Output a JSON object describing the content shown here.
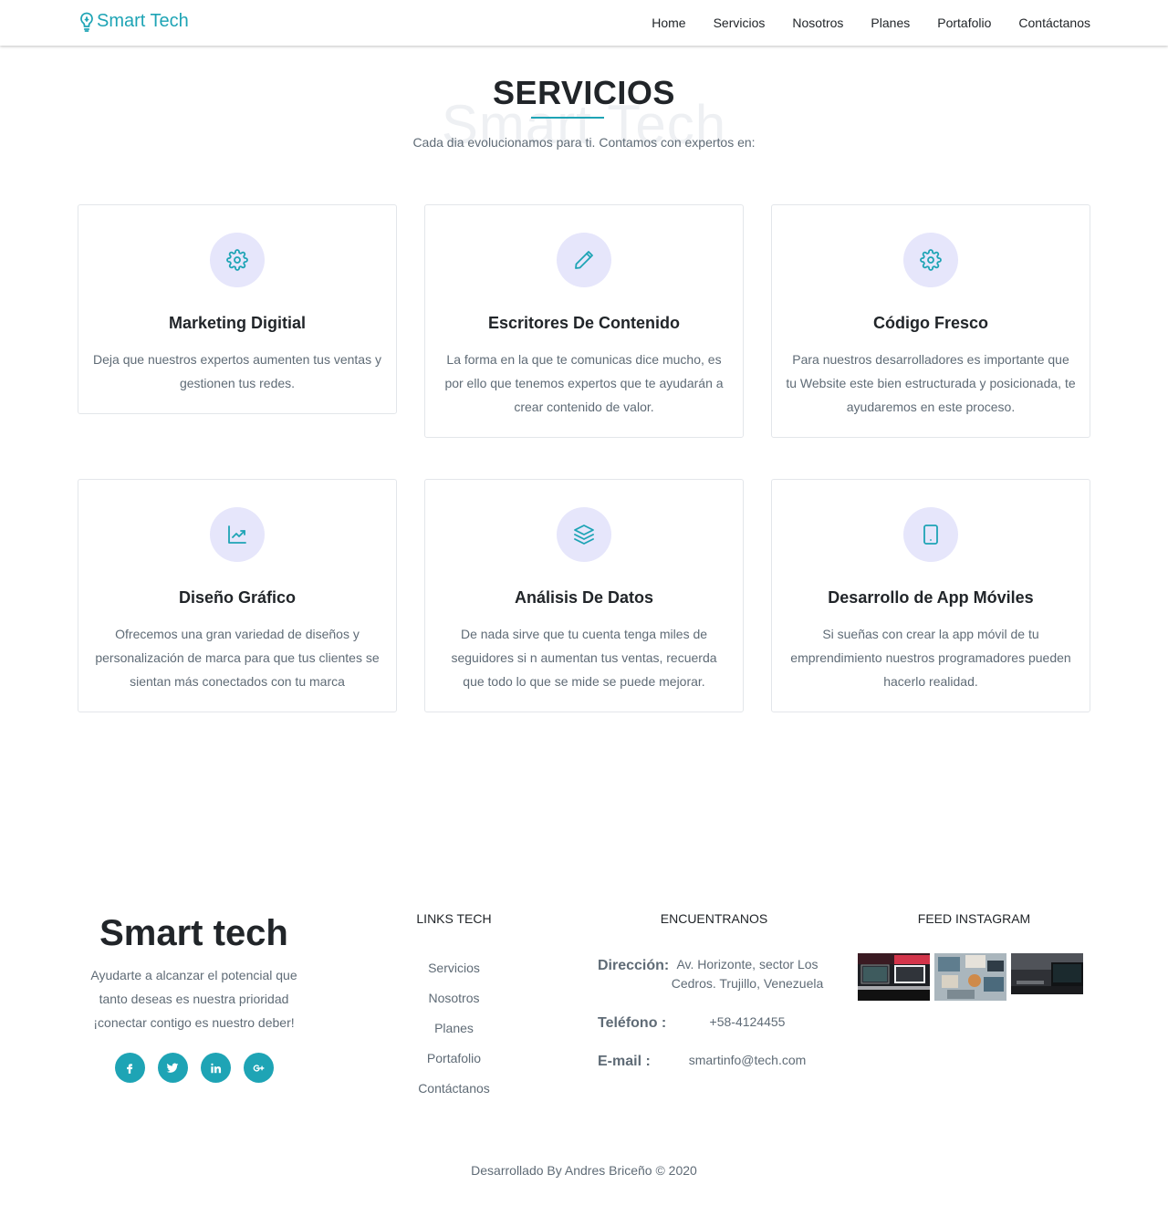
{
  "navbar": {
    "brand": "Smart Tech",
    "links": [
      "Home",
      "Servicios",
      "Nosotros",
      "Planes",
      "Portafolio",
      "Contáctanos"
    ]
  },
  "section": {
    "watermark": "Smart Tech",
    "title": "SERVICIOS",
    "subtitle": "Cada dia evolucionamos para ti. Contamos con expertos en:"
  },
  "services": [
    {
      "icon": "gear-icon",
      "title": "Marketing Digitial",
      "text": "Deja que nuestros expertos aumenten tus ventas y gestionen tus redes."
    },
    {
      "icon": "pencil-icon",
      "title": "Escritores De Contenido",
      "text": "La forma en la que te comunicas dice mucho, es por ello que tenemos expertos que te ayudarán a crear contenido de valor."
    },
    {
      "icon": "gear-icon",
      "title": "Código Fresco",
      "text": "Para nuestros desarrolladores es importante que tu Website este bien estructurada y posicionada, te ayudaremos en este proceso."
    },
    {
      "icon": "trending-chart-icon",
      "title": "Diseño Gráfico",
      "text": "Ofrecemos una gran variedad de diseños y personalización de marca para que tus clientes se sientan más conectados con tu marca"
    },
    {
      "icon": "layers-icon",
      "title": "Análisis De Datos",
      "text": "De nada sirve que tu cuenta tenga miles de seguidores si n aumentan tus ventas, recuerda que todo lo que se mide se puede mejorar."
    },
    {
      "icon": "tablet-icon",
      "title": "Desarrollo de App Móviles",
      "text": "Si sueñas con crear la app móvil de tu emprendimiento nuestros programadores pueden hacerlo realidad."
    }
  ],
  "footer": {
    "brand": "Smart tech",
    "tagline": "Ayudarte a alcanzar el potencial que tanto deseas es nuestra prioridad ¡conectar contigo es nuestro deber!",
    "socials": [
      "facebook-icon",
      "twitter-icon",
      "linkedin-icon",
      "google-plus-icon"
    ],
    "links_heading": "LINKS TECH",
    "links": [
      "Servicios",
      "Nosotros",
      "Planes",
      "Portafolio",
      "Contáctanos"
    ],
    "contact_heading": "ENCUENTRANOS",
    "contact": {
      "address_label": "Dirección:",
      "address": "Av. Horizonte, sector Los Cedros. Trujillo, Venezuela",
      "phone_label": "Teléfono :",
      "phone": "+58-4124455",
      "email_label": "E-mail :",
      "email": "smartinfo@tech.com"
    },
    "instagram_heading": "FEED INSTAGRAM",
    "copyright": "Desarrollado By Andres Briceño © 2020"
  },
  "colors": {
    "accent": "#1ea4b5",
    "icon_bg": "#e6e6fb",
    "text_muted": "#5f6b76"
  }
}
